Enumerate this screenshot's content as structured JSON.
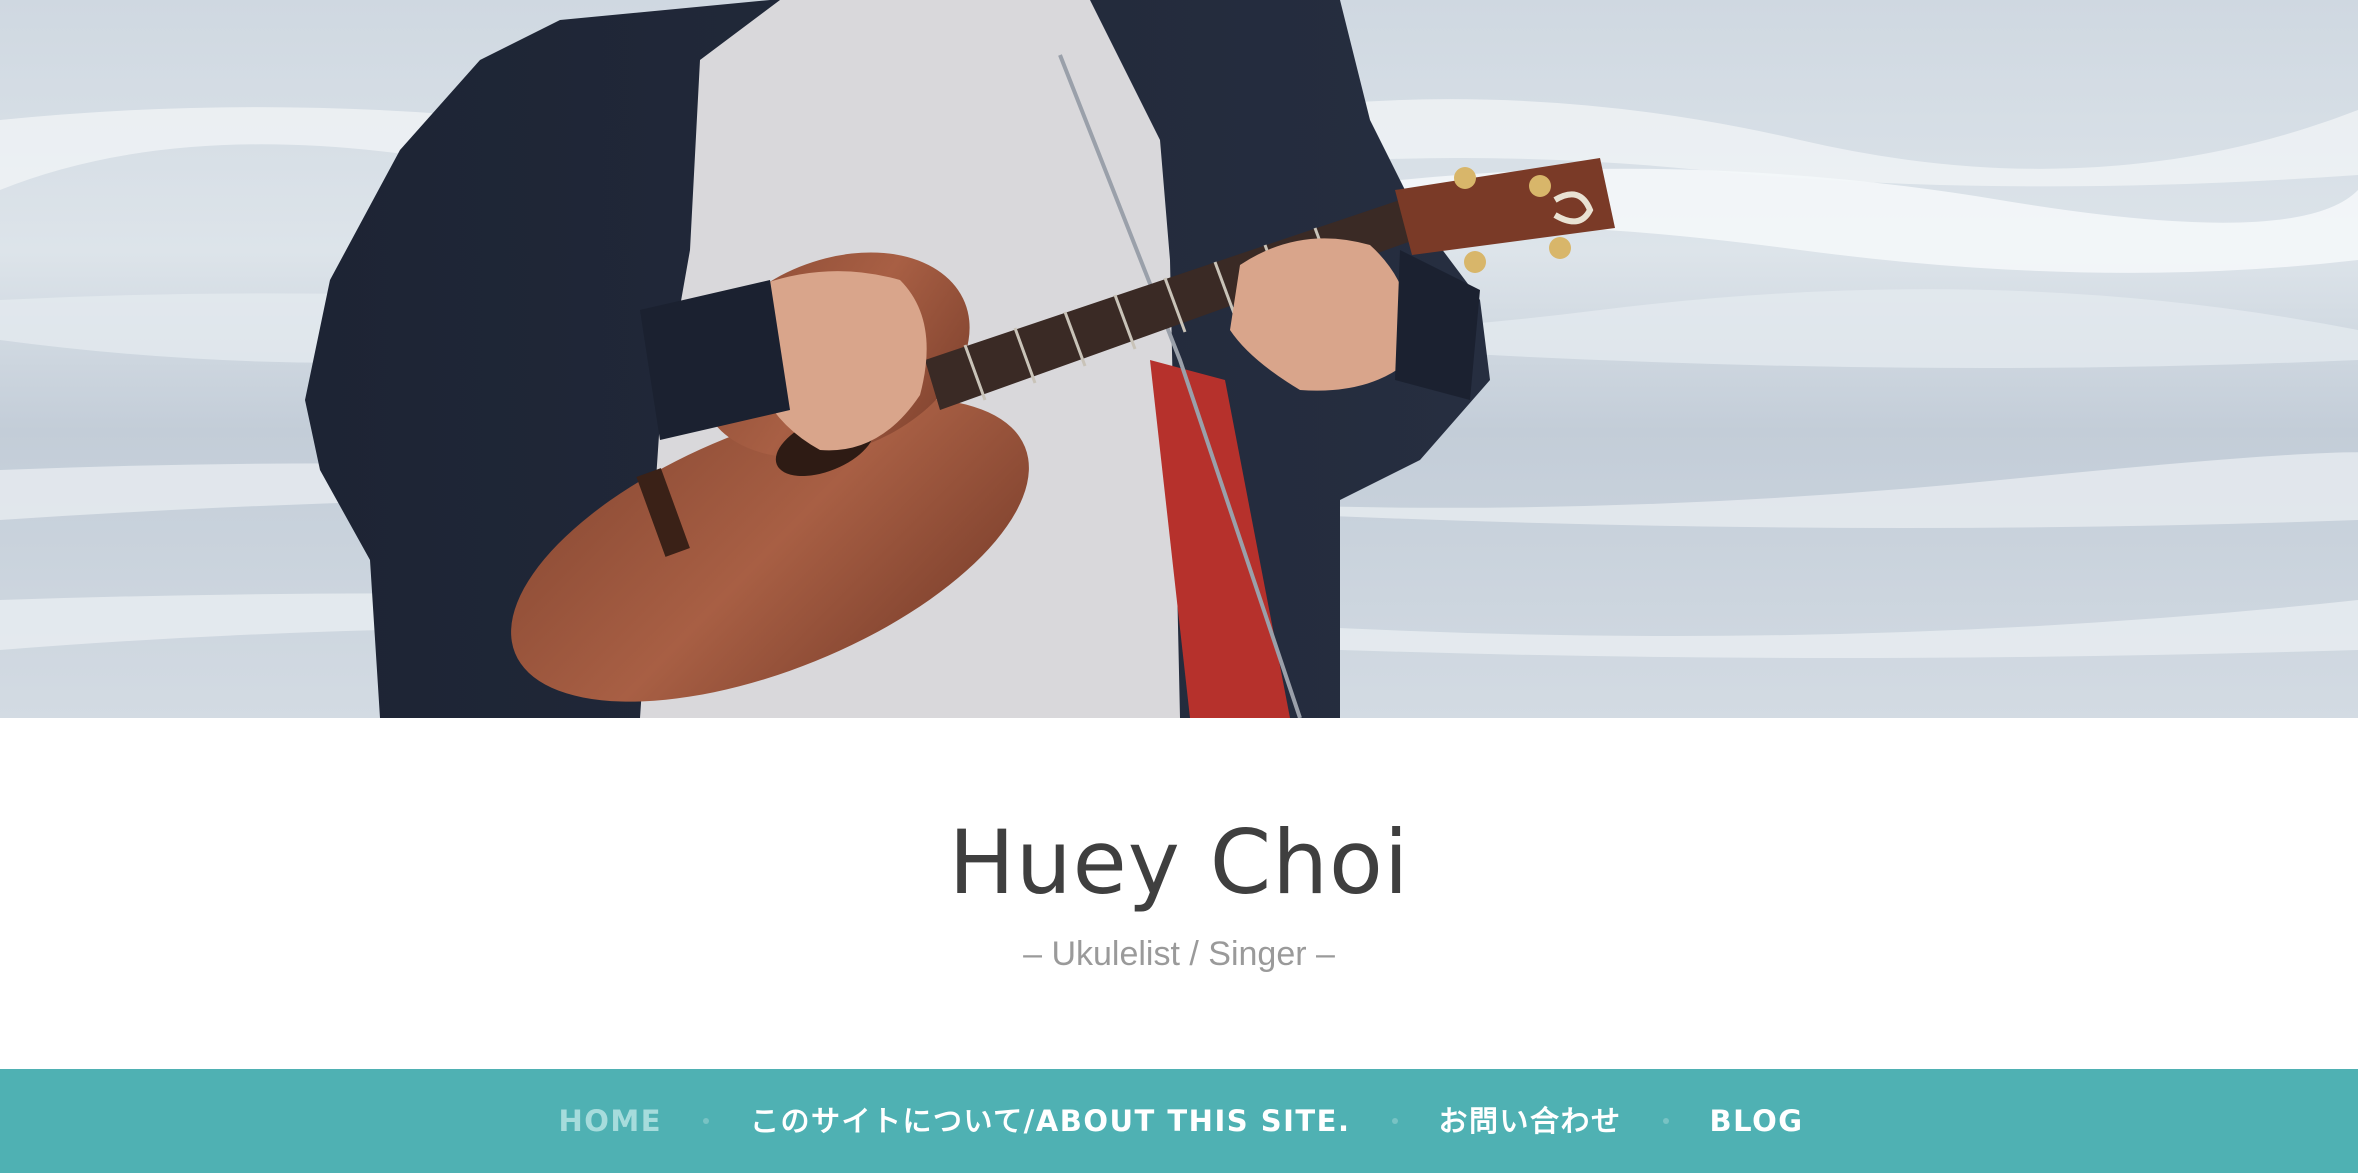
{
  "site": {
    "title": "Huey Choi",
    "tagline": "– Ukulelist / Singer –"
  },
  "hero": {
    "subject": "person playing ukulele by the sea"
  },
  "nav": {
    "items": [
      {
        "label": "HOME",
        "current": true
      },
      {
        "label": "このサイトについて/ABOUT THIS SITE.",
        "current": false
      },
      {
        "label": "お問い合わせ",
        "current": false
      },
      {
        "label": "BLOG",
        "current": false
      }
    ]
  },
  "colors": {
    "nav_background": "#4fb1b3",
    "nav_current": "#a6dcdc",
    "nav_text": "#ffffff",
    "title_text": "#3f3f3f",
    "tagline_text": "#9a9a9a"
  }
}
